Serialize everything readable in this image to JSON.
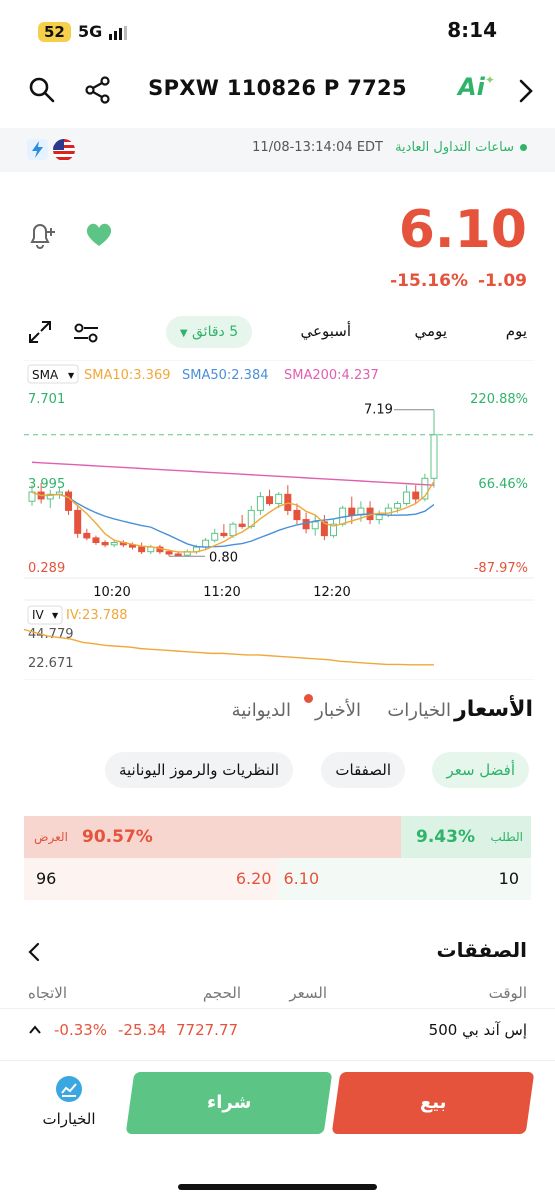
{
  "status_bar": {
    "battery": "52",
    "network": "5G",
    "time": "8:14"
  },
  "header": {
    "title": "SPXW 110826 P 7725",
    "ai_label": "Ai"
  },
  "session": {
    "status": "ساعات التداول العادية",
    "timestamp": "11/08-13:14:04 EDT"
  },
  "quote": {
    "price": "6.10",
    "change": "-1.09",
    "change_pct": "-15.16%"
  },
  "timeframe": {
    "day": "يوم",
    "daily": "يومي",
    "weekly": "أسبوعي",
    "selected": "5 دقائق"
  },
  "indicators": {
    "sma_label": "SMA",
    "sma10": "SMA10:3.369",
    "sma50": "SMA50:2.384",
    "sma200": "SMA200:4.237",
    "iv_label": "IV",
    "iv_value": "IV:23.788"
  },
  "chart_data": {
    "type": "candlestick",
    "y_left_ticks": [
      "7.701",
      "3.995",
      "0.289"
    ],
    "y_right_ticks": [
      "220.88%",
      "66.46%",
      "-87.97%"
    ],
    "x_ticks": [
      "10:20",
      "11:20",
      "12:20"
    ],
    "annotations": {
      "high": "7.19",
      "low": "0.80"
    },
    "current_price_line": 6.1,
    "ylim": [
      0.289,
      7.701
    ],
    "candles": [
      [
        3.2,
        3.9,
        3.0,
        3.6
      ],
      [
        3.6,
        4.0,
        3.1,
        3.3
      ],
      [
        3.3,
        3.7,
        2.9,
        3.5
      ],
      [
        3.5,
        3.8,
        3.3,
        3.6
      ],
      [
        3.6,
        3.7,
        2.6,
        2.8
      ],
      [
        2.8,
        3.0,
        1.6,
        1.8
      ],
      [
        1.8,
        2.0,
        1.5,
        1.6
      ],
      [
        1.6,
        1.7,
        1.3,
        1.4
      ],
      [
        1.4,
        1.5,
        1.2,
        1.3
      ],
      [
        1.3,
        1.5,
        1.2,
        1.4
      ],
      [
        1.4,
        1.5,
        1.2,
        1.3
      ],
      [
        1.3,
        1.4,
        1.1,
        1.2
      ],
      [
        1.2,
        1.4,
        0.9,
        1.0
      ],
      [
        1.0,
        1.3,
        0.9,
        1.2
      ],
      [
        1.2,
        1.3,
        0.9,
        1.0
      ],
      [
        1.0,
        1.1,
        0.8,
        0.9
      ],
      [
        0.9,
        1.0,
        0.8,
        0.85
      ],
      [
        0.85,
        1.1,
        0.8,
        1.0
      ],
      [
        1.0,
        1.3,
        0.9,
        1.2
      ],
      [
        1.2,
        1.6,
        1.1,
        1.5
      ],
      [
        1.5,
        2.0,
        1.4,
        1.8
      ],
      [
        1.8,
        2.2,
        1.6,
        1.7
      ],
      [
        1.7,
        2.3,
        1.6,
        2.2
      ],
      [
        2.2,
        2.6,
        2.0,
        2.1
      ],
      [
        2.1,
        3.0,
        2.0,
        2.8
      ],
      [
        2.8,
        3.6,
        2.6,
        3.4
      ],
      [
        3.4,
        3.7,
        3.0,
        3.1
      ],
      [
        3.1,
        3.6,
        2.9,
        3.5
      ],
      [
        3.5,
        3.9,
        2.6,
        2.8
      ],
      [
        2.8,
        3.1,
        2.2,
        2.4
      ],
      [
        2.4,
        2.7,
        1.8,
        2.0
      ],
      [
        2.0,
        2.6,
        1.7,
        2.3
      ],
      [
        2.3,
        2.6,
        1.5,
        1.7
      ],
      [
        1.7,
        2.4,
        1.6,
        2.2
      ],
      [
        2.2,
        3.0,
        2.1,
        2.9
      ],
      [
        2.9,
        3.4,
        2.2,
        2.6
      ],
      [
        2.6,
        3.2,
        2.3,
        2.9
      ],
      [
        2.9,
        3.2,
        2.2,
        2.4
      ],
      [
        2.4,
        2.8,
        2.2,
        2.6
      ],
      [
        2.6,
        3.1,
        2.5,
        2.9
      ],
      [
        2.9,
        3.2,
        2.7,
        3.1
      ],
      [
        3.1,
        3.9,
        3.0,
        3.6
      ],
      [
        3.6,
        3.9,
        3.1,
        3.3
      ],
      [
        3.3,
        4.4,
        3.2,
        4.2
      ],
      [
        4.2,
        7.19,
        3.8,
        6.1
      ]
    ],
    "iv_series": {
      "ticks": [
        "44.779",
        "22.671"
      ],
      "ylim": [
        18,
        47
      ],
      "values": [
        46,
        44,
        42,
        41,
        40,
        38,
        37,
        36,
        35.5,
        35,
        34,
        33.5,
        33,
        32.5,
        32,
        31.5,
        31,
        31,
        30.5,
        30,
        30,
        29.5,
        29,
        28.5,
        28,
        27.5,
        27,
        26,
        25.5,
        25,
        24.5,
        24,
        24,
        23.8,
        23.8,
        23.788
      ]
    }
  },
  "section_tabs": {
    "prices": "الأسعار",
    "options": "الخيارات",
    "news": "الأخبار",
    "diwaniya": "الديوانية"
  },
  "chips": {
    "best_price": "أفضل سعر",
    "trades": "الصفقات",
    "greeks": "النظريات والرموز اليونانية"
  },
  "order_book": {
    "bid_label": "الطلب",
    "bid_pct": "9.43%",
    "ask_label": "العرض",
    "ask_pct": "90.57%",
    "bid_size": "10",
    "bid_price": "6.10",
    "ask_price": "6.20",
    "ask_size": "96",
    "bid_fraction": 0.0943
  },
  "trades_section": {
    "title": "الصفقات",
    "cols": {
      "time": "الوقت",
      "price": "السعر",
      "volume": "الحجم",
      "direction": "الاتجاه"
    }
  },
  "ticker_row": {
    "name": "إس آند بي 500",
    "value": "7727.77",
    "change": "-25.34",
    "change_pct": "-0.33%"
  },
  "bottom_bar": {
    "options_label": "الخيارات",
    "buy": "شراء",
    "sell": "بيع"
  },
  "colors": {
    "up": "#5cc585",
    "down": "#e5533d",
    "accent_green": "#2fb36a",
    "sma10": "#f0a83a",
    "sma50": "#4a90d9",
    "sma200": "#e05fb0",
    "iv": "#f0a83a"
  }
}
